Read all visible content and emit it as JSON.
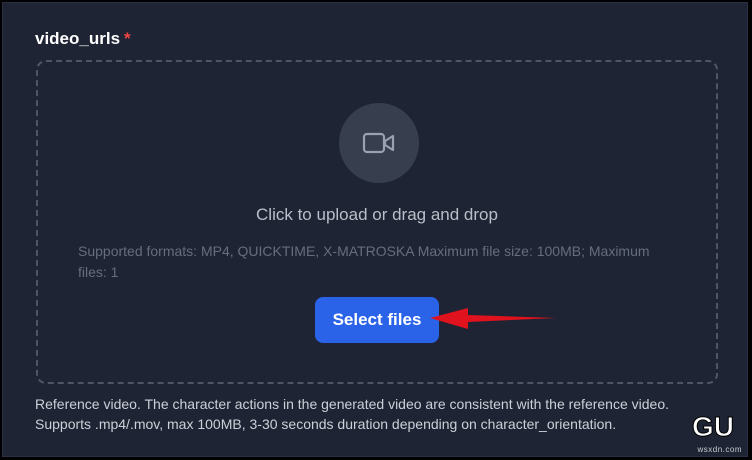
{
  "field": {
    "label": "video_urls",
    "required_marker": "*"
  },
  "dropzone": {
    "icon": "video-camera-icon",
    "title": "Click to upload or drag and drop",
    "formats_text": "Supported formats: MP4, QUICKTIME, X-MATROSKA Maximum file size: 100MB; Maximum files: 1",
    "button_label": "Select files"
  },
  "annotation": {
    "arrow_color": "#e0121e"
  },
  "help_text": "Reference video. The character actions in the generated video are consistent with the reference video. Supports .mp4/.mov, max 100MB, 3-30 seconds duration depending on character_orientation.",
  "watermark": {
    "logo_text": "GU",
    "site_text": "wsxdn.com"
  },
  "colors": {
    "panel_bg": "#1e2433",
    "accent": "#2b63e8",
    "required": "#ef4444"
  }
}
